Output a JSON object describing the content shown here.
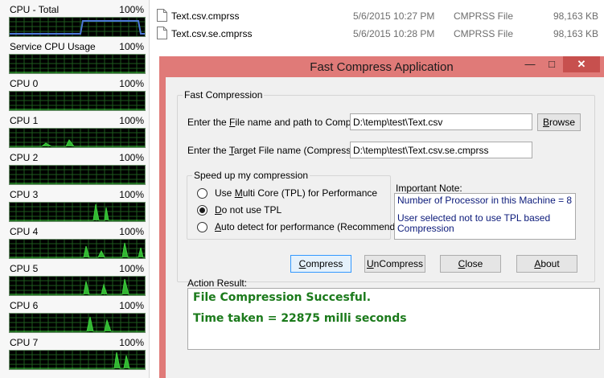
{
  "cpu_monitor": {
    "items": [
      {
        "label": "CPU - Total",
        "percent": "100%"
      },
      {
        "label": "Service CPU Usage",
        "percent": "100%"
      },
      {
        "label": "CPU 0",
        "percent": "100%"
      },
      {
        "label": "CPU 1",
        "percent": "100%"
      },
      {
        "label": "CPU 2",
        "percent": "100%"
      },
      {
        "label": "CPU 3",
        "percent": "100%"
      },
      {
        "label": "CPU 4",
        "percent": "100%"
      },
      {
        "label": "CPU 5",
        "percent": "100%"
      },
      {
        "label": "CPU 6",
        "percent": "100%"
      },
      {
        "label": "CPU 7",
        "percent": "100%"
      }
    ],
    "colors": {
      "graph_bg": "#000000",
      "grid": "#1e5a1e",
      "trace": "#3bd13b",
      "total_trace": "#4c78d8"
    }
  },
  "files": [
    {
      "name": "Text.csv.cmprss",
      "date": "5/6/2015 10:27 PM",
      "type": "CMPRSS File",
      "size": "98,163 KB"
    },
    {
      "name": "Text.csv.se.cmprss",
      "date": "5/6/2015 10:28 PM",
      "type": "CMPRSS File",
      "size": "98,163 KB"
    }
  ],
  "window": {
    "title": "Fast Compress Application",
    "minimize_glyph": "—",
    "maximize_glyph": "□",
    "close_glyph": "✕",
    "colors": {
      "frame": "#e07a78",
      "close": "#c7504e",
      "client": "#f0f0f0"
    }
  },
  "fast_compression": {
    "group_title": "Fast Compression",
    "source_label_pre": "Enter the ",
    "source_label_key": "F",
    "source_label_post": "ile name and path to Compress:",
    "source_value": "D:\\temp\\test\\Text.csv",
    "browse_key": "B",
    "browse_rest": "rowse",
    "target_label_pre": "Enter the ",
    "target_label_key": "T",
    "target_label_post": "arget File name (Compressed) :",
    "target_value": "D:\\temp\\test\\Text.csv.se.cmprss"
  },
  "speed_up": {
    "group_title": "Speed up my compression",
    "options": [
      {
        "pre": "Use ",
        "key": "M",
        "post": "ulti Core (TPL) for Performance",
        "checked": false
      },
      {
        "pre": "",
        "key": "D",
        "post": "o not use TPL",
        "checked": true
      },
      {
        "pre": "",
        "key": "A",
        "post": "uto detect for performance (Recommended)",
        "checked": false
      }
    ]
  },
  "note": {
    "label": "Important Note:",
    "line1": "Number of Processor in this Machine = 8",
    "line2": "User selected not to use TPL based Compression"
  },
  "buttons": {
    "compress": {
      "pre": "",
      "key": "C",
      "post": "ompress"
    },
    "uncompress": {
      "pre": "",
      "key": "U",
      "post": "nCompress"
    },
    "close": {
      "pre": "",
      "key": "C",
      "post": "lose"
    },
    "about": {
      "pre": "",
      "key": "A",
      "post": "bout"
    }
  },
  "action_result": {
    "label": "Action Result:",
    "line1": "File Compression Succesful.",
    "line2": "Time taken = 22875 milli seconds"
  }
}
